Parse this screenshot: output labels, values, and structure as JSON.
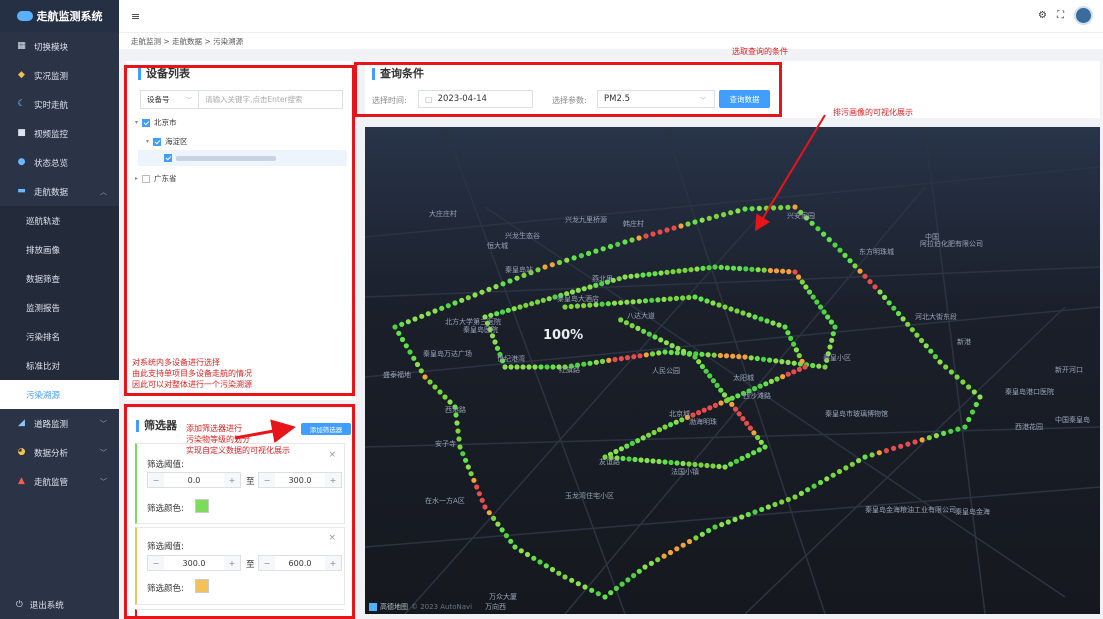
{
  "app": {
    "title": "走航监测系统"
  },
  "sidebar": {
    "items": [
      {
        "label": "切换模块",
        "icon": "grid-icon"
      },
      {
        "label": "实况监测",
        "icon": "eye-icon"
      },
      {
        "label": "实时走航",
        "icon": "crescent-icon"
      },
      {
        "label": "视频监控",
        "icon": "camera-icon"
      },
      {
        "label": "状态总览",
        "icon": "globe-icon"
      },
      {
        "label": "走航数据",
        "icon": "folder-icon"
      },
      {
        "label": "巡航轨迹"
      },
      {
        "label": "排放画像"
      },
      {
        "label": "数据筛查"
      },
      {
        "label": "监测报告"
      },
      {
        "label": "污染排名"
      },
      {
        "label": "标准比对"
      },
      {
        "label": "污染溯源"
      },
      {
        "label": "道路监测",
        "icon": "road-icon"
      },
      {
        "label": "数据分析",
        "icon": "pie-icon"
      },
      {
        "label": "走航监管",
        "icon": "warning-icon"
      }
    ],
    "logout": "退出系统"
  },
  "breadcrumb": [
    "走航监测",
    "走航数据",
    "污染溯源"
  ],
  "devices": {
    "title": "设备列表",
    "search_select": "设备号",
    "search_placeholder": "请输入关键字,点击Enter搜索",
    "tree": [
      "北京市",
      "海淀区",
      "广东省"
    ]
  },
  "query": {
    "title": "查询条件",
    "time_label": "选择时间:",
    "date": "2023-04-14",
    "param_label": "选择参数:",
    "param": "PM2.5",
    "button": "查询数据"
  },
  "filters": {
    "title": "筛选器",
    "add_button": "添加筛选器",
    "threshold_label": "筛选阈值:",
    "to": "至",
    "color_label": "筛选颜色:",
    "items": [
      {
        "min": "0.0",
        "max": "300.0",
        "color": "#7ddb5a"
      },
      {
        "min": "300.0",
        "max": "600.0",
        "color": "#f2c15a"
      }
    ]
  },
  "annotations": {
    "query": "选取查询的条件",
    "map": "排污画像的可视化展示",
    "device": [
      "对系统内多设备进行选择",
      "由此支持单项目多设备走航的情况",
      "因此可以对整体进行一个污染溯源"
    ],
    "filter": [
      "添加筛选器进行",
      "污染物等级的划分",
      "实现自定义数据的可视化展示"
    ]
  },
  "map": {
    "pois": [
      "大庄庄村",
      "兴龙九里桥源",
      "韩庄村",
      "兴安家园",
      "兴龙生态谷",
      "恒大城",
      "中国",
      "阿拉伯化肥有限公司",
      "东方明珠城",
      "秦皇岛站",
      "燕北里",
      "秦皇岛大酒店",
      "北方大学第三医院",
      "秦皇岛医院",
      "八达大道",
      "河北大街东段",
      "新港",
      "秦皇岛万达广场",
      "世纪港湾",
      "红旗路",
      "人民公园",
      "太阳城",
      "秦皇小区",
      "秦皇岛市玻璃博物馆",
      "西沙滩路",
      "西港路",
      "友谊路",
      "渤海明珠",
      "法国小镇",
      "玉龙湾住宅小区",
      "在水一方A区",
      "秦皇岛金海粮油工业有限公司",
      "西港花园",
      "中国秦皇岛",
      "秦皇岛港口医院",
      "万众大厦",
      "万向西",
      "盛泰福地",
      "北京城",
      "秦皇岛金海",
      "安子寺",
      "新开河口"
    ],
    "zoom": "100%",
    "logo": "高德地图",
    "copyright": "© 2023 AutoNavi"
  },
  "colors": {
    "accent": "#409eff",
    "annotation": "#e8141a"
  }
}
